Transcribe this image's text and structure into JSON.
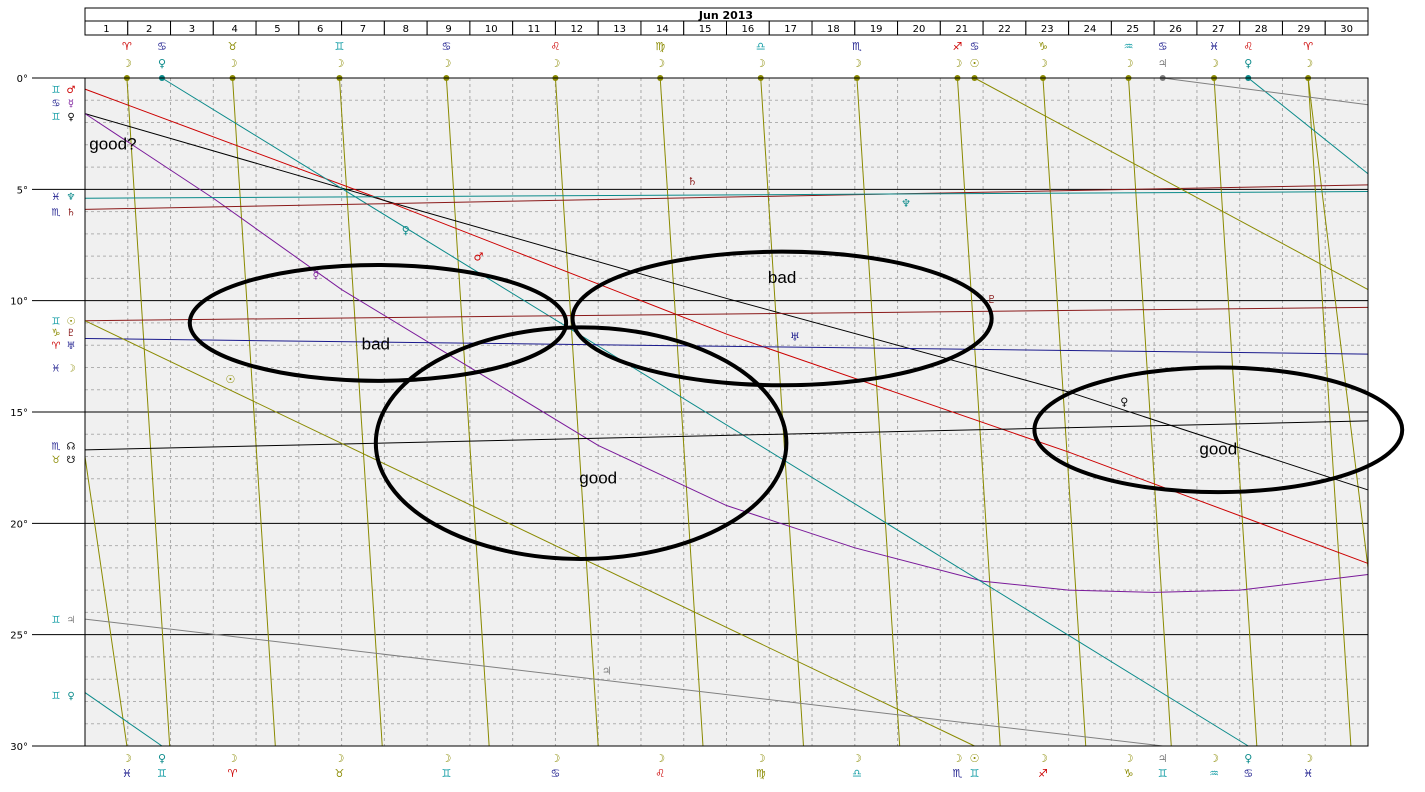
{
  "chart_data": {
    "type": "line",
    "title": "Jun 2013",
    "x": [
      1,
      2,
      3,
      4,
      5,
      6,
      7,
      8,
      9,
      10,
      11,
      12,
      13,
      14,
      15,
      16,
      17,
      18,
      19,
      20,
      21,
      22,
      23,
      24,
      25,
      26,
      27,
      28,
      29,
      30
    ],
    "xlim": [
      1,
      31
    ],
    "ylim": [
      0,
      30
    ],
    "y_ticks": [
      "0°",
      "5°",
      "10°",
      "15°",
      "20°",
      "25°",
      "30°"
    ],
    "grid": true,
    "left_markers": [
      {
        "y": 0.5,
        "sign": "♊",
        "planet": "♂",
        "sign_color": "#1aa0a8",
        "planet_color": "#cc0000"
      },
      {
        "y": 1.1,
        "sign": "♋",
        "planet": "☿",
        "sign_color": "#1a1a8c",
        "planet_color": "#7a1a9a"
      },
      {
        "y": 1.7,
        "sign": "♊",
        "planet": "♀",
        "sign_color": "#1aa0a8",
        "planet_color": "#000000"
      },
      {
        "y": 5.3,
        "sign": "♓",
        "planet": "♆",
        "sign_color": "#1a1a8c",
        "planet_color": "#0a8a8a"
      },
      {
        "y": 6.0,
        "sign": "♏",
        "planet": "♄",
        "sign_color": "#1a1a8c",
        "planet_color": "#8a1a1a"
      },
      {
        "y": 10.9,
        "sign": "♊",
        "planet": "☉",
        "sign_color": "#1aa0a8",
        "planet_color": "#8a8a00"
      },
      {
        "y": 11.4,
        "sign": "♑",
        "planet": "♇",
        "sign_color": "#8a8a00",
        "planet_color": "#8a1a1a"
      },
      {
        "y": 12.0,
        "sign": "♈",
        "planet": "♅",
        "sign_color": "#cc0000",
        "planet_color": "#1a1a8c"
      },
      {
        "y": 13.0,
        "sign": "♓",
        "planet": "☽",
        "sign_color": "#1a1a8c",
        "planet_color": "#8a8a00"
      },
      {
        "y": 16.5,
        "sign": "♏",
        "planet": "☊",
        "sign_color": "#1a1a8c",
        "planet_color": "#000000"
      },
      {
        "y": 17.1,
        "sign": "♉",
        "planet": "☋",
        "sign_color": "#8a8a00",
        "planet_color": "#000000"
      },
      {
        "y": 24.3,
        "sign": "♊",
        "planet": "♃",
        "sign_color": "#1aa0a8",
        "planet_color": "#808080"
      },
      {
        "y": 27.7,
        "sign": "♊",
        "planet": "♀",
        "sign_color": "#1aa0a8",
        "planet_color": "#0a8a8a"
      }
    ],
    "top_markers": [
      {
        "x": 1.98,
        "row1": "♈",
        "row1_color": "#cc0000",
        "row2": "☽",
        "row2_color": "#8a8a00"
      },
      {
        "x": 2.8,
        "row1": "♋",
        "row1_color": "#1a1a8c",
        "row2": "♀",
        "row2_color": "#0a8a8a"
      },
      {
        "x": 4.45,
        "row1": "♉",
        "row1_color": "#8a8a00",
        "row2": "☽",
        "row2_color": "#8a8a00"
      },
      {
        "x": 6.95,
        "row1": "♊",
        "row1_color": "#1aa0a8",
        "row2": "☽",
        "row2_color": "#8a8a00"
      },
      {
        "x": 9.45,
        "row1": "♋",
        "row1_color": "#1a1a8c",
        "row2": "☽",
        "row2_color": "#8a8a00"
      },
      {
        "x": 12.0,
        "row1": "♌",
        "row1_color": "#cc0000",
        "row2": "☽",
        "row2_color": "#8a8a00"
      },
      {
        "x": 14.45,
        "row1": "♍",
        "row1_color": "#8a8a00",
        "row2": "☽",
        "row2_color": "#8a8a00"
      },
      {
        "x": 16.8,
        "row1": "♎",
        "row1_color": "#1aa0a8",
        "row2": "☽",
        "row2_color": "#8a8a00"
      },
      {
        "x": 19.05,
        "row1": "♏",
        "row1_color": "#1a1a8c",
        "row2": "☽",
        "row2_color": "#8a8a00"
      },
      {
        "x": 21.4,
        "row1": "♐",
        "row1_color": "#cc0000",
        "row2": "☽",
        "row2_color": "#8a8a00"
      },
      {
        "x": 21.8,
        "row1": "♋",
        "row1_color": "#1a1a8c",
        "row2": "☉",
        "row2_color": "#8a8a00"
      },
      {
        "x": 23.4,
        "row1": "♑",
        "row1_color": "#8a8a00",
        "row2": "☽",
        "row2_color": "#8a8a00"
      },
      {
        "x": 25.4,
        "row1": "♒",
        "row1_color": "#1aa0a8",
        "row2": "☽",
        "row2_color": "#8a8a00"
      },
      {
        "x": 26.2,
        "row1": "♋",
        "row1_color": "#1a1a8c",
        "row2": "♃",
        "row2_color": "#808080"
      },
      {
        "x": 27.4,
        "row1": "♓",
        "row1_color": "#1a1a8c",
        "row2": "☽",
        "row2_color": "#8a8a00"
      },
      {
        "x": 28.2,
        "row1": "♌",
        "row1_color": "#cc0000",
        "row2": "♀",
        "row2_color": "#0a8a8a"
      },
      {
        "x": 29.6,
        "row1": "♈",
        "row1_color": "#cc0000",
        "row2": "☽",
        "row2_color": "#8a8a00"
      }
    ],
    "bottom_markers": [
      {
        "x": 1.98,
        "row1": "☽",
        "row1_color": "#8a8a00",
        "row2": "♓",
        "row2_color": "#1a1a8c"
      },
      {
        "x": 2.8,
        "row1": "♀",
        "row1_color": "#0a8a8a",
        "row2": "♊",
        "row2_color": "#1aa0a8"
      },
      {
        "x": 4.45,
        "row1": "☽",
        "row1_color": "#8a8a00",
        "row2": "♈",
        "row2_color": "#cc0000"
      },
      {
        "x": 6.95,
        "row1": "☽",
        "row1_color": "#8a8a00",
        "row2": "♉",
        "row2_color": "#8a8a00"
      },
      {
        "x": 9.45,
        "row1": "☽",
        "row1_color": "#8a8a00",
        "row2": "♊",
        "row2_color": "#1aa0a8"
      },
      {
        "x": 12.0,
        "row1": "☽",
        "row1_color": "#8a8a00",
        "row2": "♋",
        "row2_color": "#1a1a8c"
      },
      {
        "x": 14.45,
        "row1": "☽",
        "row1_color": "#8a8a00",
        "row2": "♌",
        "row2_color": "#cc0000"
      },
      {
        "x": 16.8,
        "row1": "☽",
        "row1_color": "#8a8a00",
        "row2": "♍",
        "row2_color": "#8a8a00"
      },
      {
        "x": 19.05,
        "row1": "☽",
        "row1_color": "#8a8a00",
        "row2": "♎",
        "row2_color": "#1aa0a8"
      },
      {
        "x": 21.4,
        "row1": "☽",
        "row1_color": "#8a8a00",
        "row2": "♏",
        "row2_color": "#1a1a8c"
      },
      {
        "x": 21.8,
        "row1": "☉",
        "row1_color": "#8a8a00",
        "row2": "♊",
        "row2_color": "#1aa0a8"
      },
      {
        "x": 23.4,
        "row1": "☽",
        "row1_color": "#8a8a00",
        "row2": "♐",
        "row2_color": "#cc0000"
      },
      {
        "x": 25.4,
        "row1": "☽",
        "row1_color": "#8a8a00",
        "row2": "♑",
        "row2_color": "#8a8a00"
      },
      {
        "x": 26.2,
        "row1": "♃",
        "row1_color": "#808080",
        "row2": "♊",
        "row2_color": "#1aa0a8"
      },
      {
        "x": 27.4,
        "row1": "☽",
        "row1_color": "#8a8a00",
        "row2": "♒",
        "row2_color": "#1aa0a8"
      },
      {
        "x": 28.2,
        "row1": "♀",
        "row1_color": "#0a8a8a",
        "row2": "♋",
        "row2_color": "#1a1a8c"
      },
      {
        "x": 29.6,
        "row1": "☽",
        "row1_color": "#8a8a00",
        "row2": "♓",
        "row2_color": "#1a1a8c"
      }
    ],
    "series": [
      {
        "glyph": "♂",
        "color": "#cc0000",
        "glyph_at": [
          10.2,
          8.2
        ],
        "points": [
          [
            1,
            0.5
          ],
          [
            8,
            5.5
          ],
          [
            16,
            11.5
          ],
          [
            24,
            16.8
          ],
          [
            31,
            21.8
          ]
        ]
      },
      {
        "glyph": "♀",
        "color": "#000000",
        "glyph_at": [
          25.3,
          14.7
        ],
        "points": [
          [
            1,
            1.6
          ],
          [
            8,
            5.5
          ],
          [
            16,
            9.9
          ],
          [
            24,
            14.1
          ],
          [
            31,
            18.5
          ]
        ]
      },
      {
        "glyph": "☿",
        "color": "#7a1a9a",
        "glyph_at": [
          6.4,
          9.0
        ],
        "points": [
          [
            1,
            1.6
          ],
          [
            4,
            5.4
          ],
          [
            7,
            9.5
          ],
          [
            10,
            13.0
          ],
          [
            13,
            16.5
          ],
          [
            16,
            19.2
          ],
          [
            19,
            21.1
          ],
          [
            22,
            22.6
          ],
          [
            24,
            23.0
          ],
          [
            26,
            23.1
          ],
          [
            28,
            23.0
          ],
          [
            31,
            22.3
          ]
        ]
      },
      {
        "glyph": "♀",
        "color": "#0a8a8a",
        "glyph_at": [
          8.5,
          7.0
        ],
        "points": [
          [
            2.8,
            0
          ],
          [
            10,
            8.5
          ],
          [
            20,
            20.3
          ],
          [
            28.2,
            30
          ]
        ]
      },
      {
        "glyph": "♀",
        "color": "#0a8a8a",
        "glyph_at": null,
        "points": [
          [
            28.2,
            0
          ],
          [
            31,
            4.3
          ]
        ]
      },
      {
        "glyph": "♀",
        "color": "#0a8a8a",
        "glyph_at": null,
        "points": [
          [
            1,
            27.6
          ],
          [
            2.8,
            30
          ]
        ]
      },
      {
        "glyph": "♄",
        "color": "#8a1a1a",
        "glyph_at": [
          15.2,
          4.8
        ],
        "points": [
          [
            1,
            5.9
          ],
          [
            31,
            4.8
          ]
        ]
      },
      {
        "glyph": "♆",
        "color": "#0a8a8a",
        "glyph_at": [
          20.2,
          5.8
        ],
        "points": [
          [
            1,
            5.4
          ],
          [
            31,
            5.1
          ]
        ]
      },
      {
        "glyph": "♇",
        "color": "#8a1a1a",
        "glyph_at": [
          22.2,
          10.1
        ],
        "points": [
          [
            1,
            10.9
          ],
          [
            31,
            10.3
          ]
        ]
      },
      {
        "glyph": "♅",
        "color": "#1a1a8c",
        "glyph_at": [
          17.6,
          11.8
        ],
        "points": [
          [
            1,
            11.7
          ],
          [
            31,
            12.4
          ]
        ]
      },
      {
        "glyph": "☊",
        "color": "#000000",
        "glyph_at": null,
        "points": [
          [
            1,
            16.7
          ],
          [
            31,
            15.4
          ]
        ]
      },
      {
        "glyph": "☉",
        "color": "#8a8a00",
        "glyph_at": [
          4.4,
          13.7
        ],
        "points": [
          [
            1,
            10.9
          ],
          [
            21.8,
            30
          ]
        ]
      },
      {
        "glyph": "☉",
        "color": "#8a8a00",
        "glyph_at": null,
        "points": [
          [
            21.8,
            0
          ],
          [
            31,
            9.5
          ]
        ]
      },
      {
        "glyph": "♃",
        "color": "#808080",
        "glyph_at": [
          13.2,
          26.8
        ],
        "points": [
          [
            1,
            24.3
          ],
          [
            26.2,
            30
          ]
        ]
      },
      {
        "glyph": "♃",
        "color": "#808080",
        "glyph_at": null,
        "points": [
          [
            26.2,
            0
          ],
          [
            31,
            1.2
          ]
        ]
      }
    ],
    "moon_diagonals": {
      "color": "#8a8a00",
      "top_x": [
        1.98,
        4.45,
        6.95,
        9.45,
        12.0,
        14.45,
        16.8,
        19.05,
        21.4,
        23.4,
        25.4,
        27.4,
        29.6
      ],
      "slope_days": 1.0,
      "extra": [
        {
          "from": [
            1,
            17.0
          ],
          "to": [
            1.98,
            30
          ]
        },
        {
          "from": [
            29.6,
            0
          ],
          "to": [
            31,
            22.0
          ]
        }
      ]
    },
    "annotations": [
      {
        "text": "good?",
        "x": 1.1,
        "y": 3.2
      },
      {
        "text": "bad",
        "x": 7.8,
        "y": 12.2
      },
      {
        "text": "bad",
        "x": 17.3,
        "y": 9.2
      },
      {
        "text": "good",
        "x": 13.0,
        "y": 18.2
      },
      {
        "text": "good",
        "x": 27.5,
        "y": 16.9
      }
    ],
    "ellipses": [
      {
        "cx": 7.85,
        "cy": 11.0,
        "rx": 4.4,
        "ry": 2.6
      },
      {
        "cx": 17.3,
        "cy": 10.8,
        "rx": 4.9,
        "ry": 3.0
      },
      {
        "cx": 12.6,
        "cy": 16.4,
        "rx": 4.8,
        "ry": 5.2
      },
      {
        "cx": 27.5,
        "cy": 15.8,
        "rx": 4.3,
        "ry": 2.8
      }
    ]
  }
}
